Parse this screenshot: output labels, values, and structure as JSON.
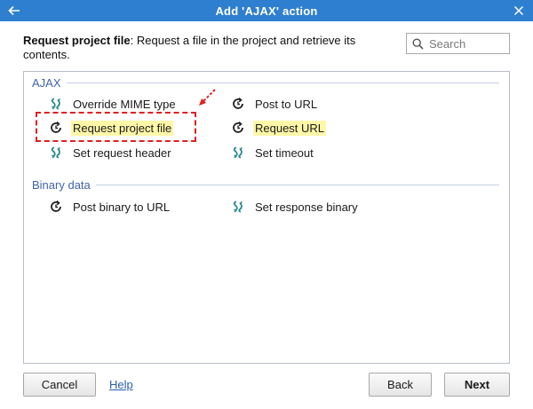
{
  "window": {
    "title": "Add 'AJAX' action"
  },
  "description": {
    "name": "Request project file",
    "text": ": Request a file in the project and retrieve its contents."
  },
  "search": {
    "placeholder": "Search"
  },
  "sections": [
    {
      "label": "AJAX",
      "items": [
        {
          "label": "Override MIME type",
          "icon": "swap-icon"
        },
        {
          "label": "Post to URL",
          "icon": "refresh-icon"
        },
        {
          "label": "Request project file",
          "icon": "refresh-icon",
          "highlighted": true
        },
        {
          "label": "Request URL",
          "icon": "refresh-icon",
          "highlighted": true
        },
        {
          "label": "Set request header",
          "icon": "swap-icon"
        },
        {
          "label": "Set timeout",
          "icon": "swap-icon"
        }
      ]
    },
    {
      "label": "Binary data",
      "items": [
        {
          "label": "Post binary to URL",
          "icon": "refresh-icon"
        },
        {
          "label": "Set response binary",
          "icon": "swap-icon"
        }
      ]
    }
  ],
  "footer": {
    "cancel_label": "Cancel",
    "help_label": "Help",
    "back_label": "Back",
    "next_label": "Next"
  },
  "colors": {
    "titlebar": "#2f7fd0",
    "section_label": "#3f63b0",
    "highlight": "#fff7a8",
    "swap_icon": "#2a8c8c",
    "annotation": "#e02020"
  }
}
